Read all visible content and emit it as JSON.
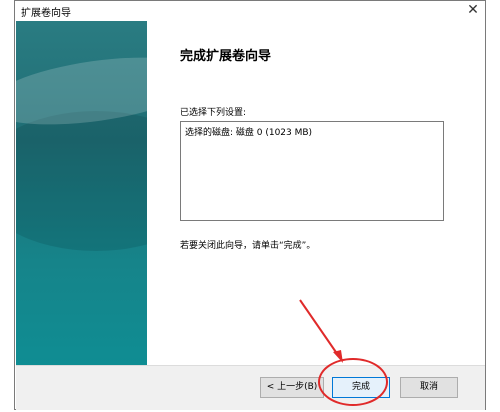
{
  "window": {
    "title": "扩展卷向导"
  },
  "wizard": {
    "heading": "完成扩展卷向导",
    "settings_label": "已选择下列设置:",
    "settings_text": "选择的磁盘: 磁盘 0 (1023 MB)",
    "instruction": "若要关闭此向导，请单击“完成”。"
  },
  "buttons": {
    "back": "< 上一步(B)",
    "finish": "完成",
    "cancel": "取消"
  },
  "icons": {
    "close": "close-icon"
  },
  "colors": {
    "annotation": "#e02a2a",
    "sidebar": "#1f6d74",
    "focus_border": "#0078d7"
  }
}
